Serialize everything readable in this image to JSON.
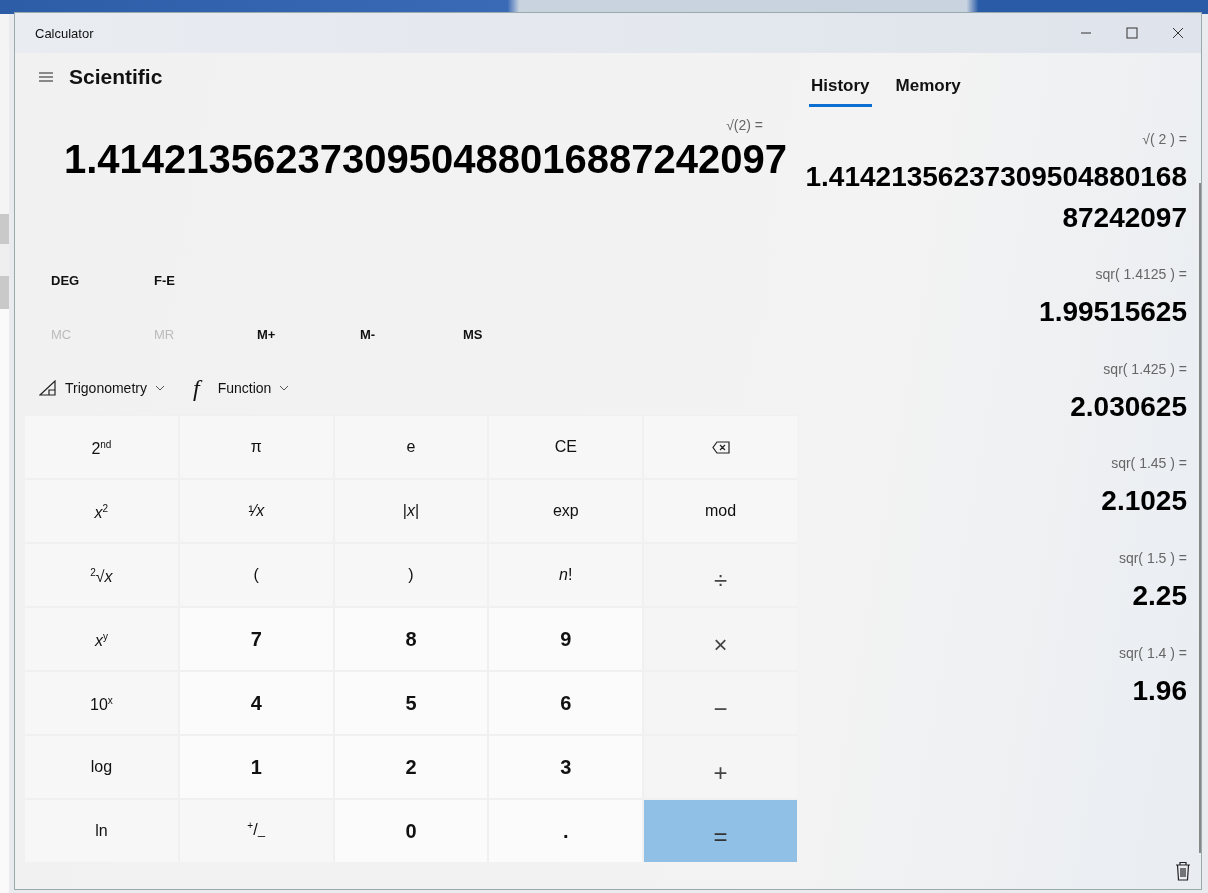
{
  "window": {
    "title": "Calculator"
  },
  "header": {
    "mode": "Scientific"
  },
  "display": {
    "expression": "√(2) =",
    "value": "1.4142135623730950488016887242097"
  },
  "mode_buttons": [
    {
      "label": "DEG"
    },
    {
      "label": "F-E"
    }
  ],
  "memory_buttons": [
    {
      "label": "MC",
      "disabled": true
    },
    {
      "label": "MR",
      "disabled": true
    },
    {
      "label": "M+",
      "disabled": false
    },
    {
      "label": "M-",
      "disabled": false
    },
    {
      "label": "MS",
      "disabled": false
    }
  ],
  "dropdowns": [
    {
      "label": "Trigonometry",
      "kind": "triangle"
    },
    {
      "label": "Function",
      "kind": "glyph",
      "glyph": "f"
    }
  ],
  "keys": [
    {
      "label": "2$^{nd}$",
      "kind": "function"
    },
    {
      "label": "π",
      "kind": "function"
    },
    {
      "label": "e",
      "kind": "function"
    },
    {
      "label": "CE",
      "kind": "function"
    },
    {
      "kind": "backspace"
    },
    {
      "label": "*x*$^{2}$",
      "kind": "function"
    },
    {
      "label": "¹⁄*x*",
      "kind": "function"
    },
    {
      "label": "|*x*|",
      "kind": "function"
    },
    {
      "label": "exp",
      "kind": "function"
    },
    {
      "label": "mod",
      "kind": "function"
    },
    {
      "label": "$^{2}$√*x*",
      "kind": "function"
    },
    {
      "label": "(",
      "kind": "function"
    },
    {
      "label": ")",
      "kind": "function"
    },
    {
      "label": "*n*!",
      "kind": "function"
    },
    {
      "label": "÷",
      "kind": "operator"
    },
    {
      "label": "*x*$^{y}$",
      "kind": "function"
    },
    {
      "label": "7",
      "kind": "digit"
    },
    {
      "label": "8",
      "kind": "digit"
    },
    {
      "label": "9",
      "kind": "digit"
    },
    {
      "label": "×",
      "kind": "operator"
    },
    {
      "label": "10$^{x}$",
      "kind": "function"
    },
    {
      "label": "4",
      "kind": "digit"
    },
    {
      "label": "5",
      "kind": "digit"
    },
    {
      "label": "6",
      "kind": "digit"
    },
    {
      "label": "−",
      "kind": "operator"
    },
    {
      "label": "log",
      "kind": "function"
    },
    {
      "label": "1",
      "kind": "digit"
    },
    {
      "label": "2",
      "kind": "digit"
    },
    {
      "label": "3",
      "kind": "digit"
    },
    {
      "label": "+",
      "kind": "operator"
    },
    {
      "label": "ln",
      "kind": "function"
    },
    {
      "label": "$^{+}$/$_{–}$",
      "kind": "function"
    },
    {
      "label": "0",
      "kind": "digit"
    },
    {
      "label": ".",
      "kind": "digit"
    },
    {
      "label": "=",
      "kind": "equals"
    }
  ],
  "tabs": [
    {
      "label": "History",
      "selected": true
    },
    {
      "label": "Memory",
      "selected": false
    }
  ],
  "history": [
    {
      "expression": "√( 2 ) =",
      "result": "1.4142135623730950488016887242097"
    },
    {
      "expression": "sqr( 1.4125 ) =",
      "result": "1.99515625"
    },
    {
      "expression": "sqr( 1.425 ) =",
      "result": "2.030625"
    },
    {
      "expression": "sqr( 1.45 ) =",
      "result": "2.1025"
    },
    {
      "expression": "sqr( 1.5 ) =",
      "result": "2.25"
    },
    {
      "expression": "sqr( 1.4 ) =",
      "result": "1.96"
    }
  ]
}
